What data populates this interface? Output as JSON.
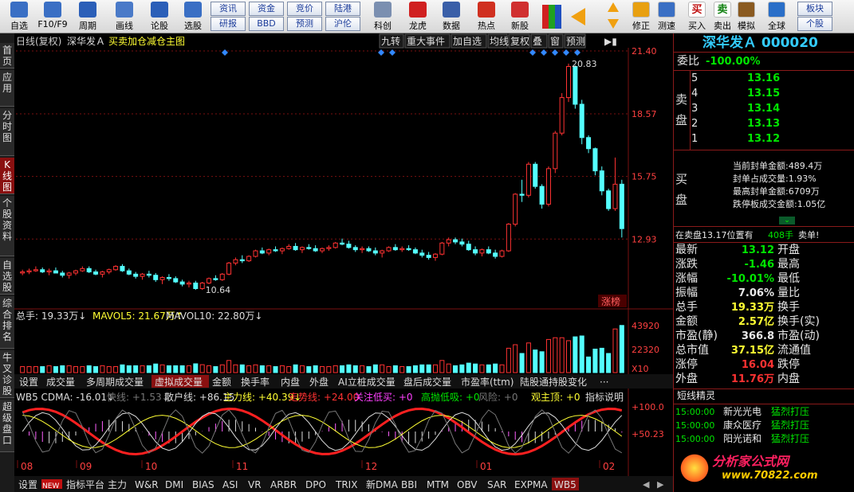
{
  "toolbar": {
    "buttons": [
      {
        "label": "自选",
        "icon": "grid-icon"
      },
      {
        "label": "F10/F9",
        "icon": "document-icon"
      },
      {
        "label": "周期",
        "icon": "clock-icon"
      },
      {
        "label": "画线",
        "icon": "pencil-icon"
      },
      {
        "label": "论股",
        "icon": "forum-icon"
      },
      {
        "label": "选股",
        "icon": "chart-circle-icon"
      }
    ],
    "small_buttons": [
      {
        "label": "资讯"
      },
      {
        "label": "资金"
      },
      {
        "label": "竞价"
      },
      {
        "label": "陆港"
      },
      {
        "label": "研报"
      },
      {
        "label": "BBD"
      },
      {
        "label": "预测"
      },
      {
        "label": "沪伦"
      }
    ],
    "buttons2": [
      {
        "label": "科创",
        "icon": "chart-icon"
      },
      {
        "label": "龙虎",
        "icon": "dragon-icon"
      },
      {
        "label": "数据",
        "icon": "pe-icon"
      },
      {
        "label": "热点",
        "icon": "hot-icon"
      },
      {
        "label": "新股",
        "icon": "newstock-icon"
      }
    ],
    "buttons3": [
      {
        "label": "修正",
        "icon": "correct-icon"
      },
      {
        "label": "测速",
        "icon": "speed-icon"
      },
      {
        "label": "买入",
        "icon": "buy-icon",
        "glyph": "买"
      },
      {
        "label": "卖出",
        "icon": "sell-icon",
        "glyph": "卖"
      },
      {
        "label": "模拟",
        "icon": "hammer-icon"
      },
      {
        "label": "全球",
        "icon": "globe-icon"
      }
    ],
    "right_small": [
      {
        "label": "板块"
      },
      {
        "label": "个股"
      }
    ]
  },
  "left_tabs": [
    {
      "label": "首页"
    },
    {
      "label": "应用"
    },
    {
      "label": "分时图"
    },
    {
      "label": "K线图",
      "active": true
    },
    {
      "label": "个股资料"
    },
    {
      "label": "自选股"
    },
    {
      "label": "综合排名"
    },
    {
      "label": "牛叉诊股"
    },
    {
      "label": "超级盘口"
    }
  ],
  "chart_header": {
    "period": "日线(复权)",
    "stock": "深华发Ａ",
    "indicator": "买卖加仓减仓主图",
    "buttons": [
      "九转",
      "重大事件",
      "加自选",
      "均线",
      "复权",
      "叠",
      "窗",
      "预测"
    ]
  },
  "chart_data": {
    "type": "candlestick",
    "price_axis": [
      "21.40",
      "18.57",
      "15.75",
      "12.93"
    ],
    "price_range": [
      10.0,
      21.4
    ],
    "annotations": {
      "high": "20.83",
      "low": "10.64"
    },
    "badge": "涨榜",
    "volume_label": "总手: 19.33万↓",
    "mavol5": "MAVOL5: 21.67万↑",
    "mavol10": "MAVOL10: 22.80万↓",
    "volume_axis": [
      "43920",
      "22320"
    ],
    "volume_unit": "X10",
    "x_labels": [
      "08",
      "09",
      "10",
      "11",
      "12",
      "01",
      "02"
    ],
    "ohlc": [
      [
        11.4,
        11.55,
        11.3,
        11.45
      ],
      [
        11.45,
        11.6,
        11.35,
        11.5
      ],
      [
        11.5,
        11.7,
        11.45,
        11.55
      ],
      [
        11.55,
        11.65,
        11.4,
        11.45
      ],
      [
        11.45,
        11.6,
        11.3,
        11.5
      ],
      [
        11.5,
        11.65,
        11.4,
        11.4
      ],
      [
        11.4,
        11.5,
        11.2,
        11.3
      ],
      [
        11.3,
        11.45,
        11.15,
        11.4
      ],
      [
        11.4,
        11.55,
        11.3,
        11.5
      ],
      [
        11.5,
        11.7,
        11.45,
        11.6
      ],
      [
        11.6,
        11.7,
        11.4,
        11.45
      ],
      [
        11.45,
        11.55,
        11.3,
        11.35
      ],
      [
        11.35,
        11.5,
        11.2,
        11.45
      ],
      [
        11.45,
        11.6,
        11.35,
        11.55
      ],
      [
        11.55,
        11.75,
        11.5,
        11.7
      ],
      [
        11.7,
        11.8,
        11.45,
        11.5
      ],
      [
        11.5,
        11.6,
        11.3,
        11.35
      ],
      [
        11.35,
        11.45,
        11.15,
        11.25
      ],
      [
        11.25,
        11.4,
        11.1,
        11.35
      ],
      [
        11.35,
        11.5,
        11.2,
        11.3
      ],
      [
        11.3,
        11.4,
        11.0,
        11.1
      ],
      [
        11.1,
        11.25,
        10.9,
        11.2
      ],
      [
        11.2,
        11.35,
        11.05,
        11.15
      ],
      [
        11.15,
        11.25,
        10.95,
        11.0
      ],
      [
        11.0,
        11.1,
        10.8,
        10.9
      ],
      [
        10.9,
        11.05,
        10.75,
        10.95
      ],
      [
        10.95,
        11.05,
        10.64,
        10.7
      ],
      [
        10.7,
        11.0,
        10.64,
        10.95
      ],
      [
        10.95,
        11.2,
        10.9,
        11.15
      ],
      [
        11.15,
        11.3,
        11.05,
        11.1
      ],
      [
        11.1,
        11.4,
        11.05,
        11.35
      ],
      [
        11.35,
        11.9,
        11.3,
        11.85
      ],
      [
        11.85,
        12.1,
        11.75,
        12.0
      ],
      [
        12.0,
        12.2,
        11.85,
        11.95
      ],
      [
        11.95,
        12.2,
        11.9,
        12.15
      ],
      [
        12.15,
        12.45,
        12.1,
        12.4
      ],
      [
        12.4,
        12.55,
        12.25,
        12.3
      ],
      [
        12.3,
        12.5,
        12.2,
        12.45
      ],
      [
        12.45,
        12.6,
        12.35,
        12.4
      ],
      [
        12.4,
        12.55,
        12.25,
        12.5
      ],
      [
        12.5,
        12.7,
        12.45,
        12.6
      ],
      [
        12.6,
        12.75,
        12.4,
        12.45
      ],
      [
        12.45,
        12.6,
        12.3,
        12.55
      ],
      [
        12.55,
        12.7,
        12.45,
        12.5
      ],
      [
        12.5,
        12.65,
        12.35,
        12.4
      ],
      [
        12.4,
        12.55,
        12.3,
        12.5
      ],
      [
        12.5,
        12.65,
        12.4,
        12.55
      ],
      [
        12.55,
        12.8,
        12.5,
        12.75
      ],
      [
        12.75,
        12.95,
        12.65,
        12.7
      ],
      [
        12.7,
        12.85,
        12.5,
        12.55
      ],
      [
        12.55,
        12.65,
        12.35,
        12.45
      ],
      [
        12.45,
        12.6,
        12.3,
        12.5
      ],
      [
        12.5,
        12.6,
        12.35,
        12.4
      ],
      [
        12.4,
        12.55,
        12.2,
        12.3
      ],
      [
        12.3,
        12.45,
        12.1,
        12.4
      ],
      [
        12.4,
        12.6,
        12.35,
        12.55
      ],
      [
        12.55,
        12.7,
        12.4,
        12.45
      ],
      [
        12.45,
        12.6,
        12.35,
        12.5
      ],
      [
        12.5,
        12.65,
        12.4,
        12.45
      ],
      [
        12.45,
        12.55,
        12.25,
        12.3
      ],
      [
        12.3,
        12.45,
        12.1,
        12.2
      ],
      [
        12.2,
        12.35,
        12.0,
        12.1
      ],
      [
        12.1,
        12.3,
        11.95,
        12.25
      ],
      [
        12.25,
        12.8,
        12.2,
        12.75
      ],
      [
        12.75,
        13.0,
        12.6,
        12.9
      ],
      [
        12.9,
        13.0,
        12.7,
        12.8
      ],
      [
        12.8,
        12.95,
        12.6,
        12.7
      ],
      [
        12.7,
        12.85,
        12.4,
        12.45
      ],
      [
        12.45,
        12.6,
        12.2,
        12.3
      ],
      [
        12.3,
        12.5,
        12.15,
        12.45
      ],
      [
        12.45,
        12.6,
        12.25,
        12.3
      ],
      [
        12.3,
        12.45,
        12.05,
        12.15
      ],
      [
        12.15,
        12.45,
        12.1,
        12.4
      ],
      [
        12.4,
        13.65,
        12.35,
        13.6
      ],
      [
        13.6,
        15.0,
        13.5,
        14.95
      ],
      [
        14.95,
        15.6,
        14.6,
        14.9
      ],
      [
        14.9,
        16.4,
        14.8,
        16.3
      ],
      [
        16.3,
        16.4,
        15.2,
        15.3
      ],
      [
        15.3,
        15.4,
        14.3,
        14.5
      ],
      [
        14.5,
        16.2,
        14.4,
        16.1
      ],
      [
        16.1,
        17.8,
        15.9,
        17.7
      ],
      [
        17.7,
        19.5,
        17.6,
        19.3
      ],
      [
        19.3,
        20.83,
        19.1,
        20.7
      ],
      [
        20.7,
        20.75,
        18.8,
        19.0
      ],
      [
        19.0,
        19.2,
        17.2,
        17.5
      ],
      [
        17.5,
        17.6,
        16.8,
        17.0
      ],
      [
        17.0,
        17.05,
        15.8,
        16.0
      ],
      [
        16.0,
        16.2,
        14.9,
        15.1
      ],
      [
        15.1,
        15.2,
        14.2,
        14.3
      ],
      [
        14.3,
        16.6,
        14.2,
        15.4
      ],
      [
        15.4,
        15.6,
        13.0,
        13.4
      ]
    ]
  },
  "bottom_tabs": {
    "row1": [
      {
        "label": "设置"
      },
      {
        "label": "成交量"
      },
      {
        "label": "多周期成交量"
      },
      {
        "label": "虚拟成交量",
        "active": true
      },
      {
        "label": "金额"
      },
      {
        "label": "换手率"
      },
      {
        "label": "内盘"
      },
      {
        "label": "外盘"
      },
      {
        "label": "AI立桩成交量"
      },
      {
        "label": "盘后成交量"
      },
      {
        "label": "市盈率(ttm)"
      },
      {
        "label": "陆股通持股变化"
      },
      {
        "label": "···"
      }
    ],
    "row2": [
      {
        "label": "设置"
      },
      {
        "label": "NEW"
      },
      {
        "label": "指标平台"
      },
      {
        "label": "主力"
      },
      {
        "label": "W&R"
      },
      {
        "label": "DMI"
      },
      {
        "label": "BIAS"
      },
      {
        "label": "ASI"
      },
      {
        "label": "VR"
      },
      {
        "label": "ARBR"
      },
      {
        "label": "DPO"
      },
      {
        "label": "TRIX"
      },
      {
        "label": "新DMA"
      },
      {
        "label": "BBI"
      },
      {
        "label": "MTM"
      },
      {
        "label": "OBV"
      },
      {
        "label": "SAR"
      },
      {
        "label": "EXPMA"
      },
      {
        "label": "WB5",
        "active": true
      }
    ]
  },
  "indicator_line": {
    "name": "WB5 CDMA: -16.01↓",
    "kuaixian": "快线: +1.53↓",
    "sanhu": "散户线: +86.15",
    "zhuli": "主力线: +40.39↓",
    "zoushi": "走势线: +24.00",
    "guanzhu": "关注低买: +0",
    "gaopao": "高抛低吸: +0",
    "fengxian": "风险: +0",
    "guancha": "观主顶: +0",
    "shuoming": "指标说明",
    "axis": [
      "+100.0",
      "+50.23"
    ]
  },
  "right_panel": {
    "title": "深华发Ａ 000020",
    "weibi_label": "委比",
    "weibi_value": "-100.00%",
    "sell_label": "卖\n盘",
    "sell": [
      {
        "lvl": "5",
        "price": "13.16"
      },
      {
        "lvl": "4",
        "price": "13.15"
      },
      {
        "lvl": "3",
        "price": "13.14"
      },
      {
        "lvl": "2",
        "price": "13.13"
      },
      {
        "lvl": "1",
        "price": "13.12"
      }
    ],
    "buy_label": "买\n盘",
    "buy_info": [
      "当前封单金额:489.4万",
      "封单占成交量:1.93%",
      "最高封单金额:6709万",
      "跌停板成交金额:1.05亿"
    ],
    "status": {
      "left": "在卖盘13.17位置有",
      "qty": "408手",
      "act": "卖单!"
    },
    "quotes": [
      {
        "l": "最新",
        "v": "13.12",
        "vc": "green",
        "r": "开盘"
      },
      {
        "l": "涨跌",
        "v": "-1.46",
        "vc": "green",
        "r": "最高"
      },
      {
        "l": "涨幅",
        "v": "-10.01%",
        "vc": "green",
        "r": "最低"
      },
      {
        "l": "振幅",
        "v": "7.06%",
        "vc": "white",
        "r": "量比"
      },
      {
        "l": "总手",
        "v": "19.33万",
        "vc": "yellow",
        "r": "换手"
      },
      {
        "l": "金额",
        "v": "2.57亿",
        "vc": "yellow",
        "r": "换手(实)"
      },
      {
        "l": "市盈(静)",
        "v": "366.8",
        "vc": "white",
        "r": "市盈(动)"
      },
      {
        "l": "总市值",
        "v": "37.15亿",
        "vc": "yellow",
        "r": "流通值"
      },
      {
        "l": "涨停",
        "v": "16.04",
        "vc": "red",
        "r": "跌停"
      },
      {
        "l": "外盘",
        "v": "11.76万",
        "vc": "red",
        "r": "内盘"
      }
    ],
    "short_title": "短线精灵",
    "short_items": [
      {
        "t": "15:00:00",
        "n": "新光光电",
        "a": "猛烈打压"
      },
      {
        "t": "15:00:00",
        "n": "康众医疗",
        "a": "猛烈打压"
      },
      {
        "t": "15:00:00",
        "n": "阳光诺和",
        "a": "猛烈打压"
      }
    ],
    "watermark_1": "分析家公式网",
    "watermark_2": "www.70822.com"
  }
}
